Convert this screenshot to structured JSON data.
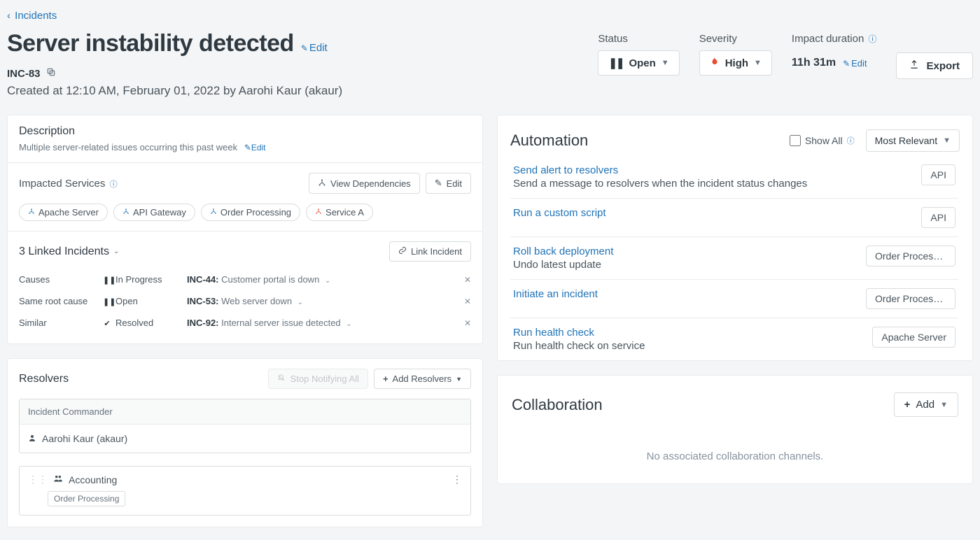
{
  "breadcrumb": {
    "label": "Incidents"
  },
  "title": "Server instability detected",
  "title_edit": "Edit",
  "incident_id": "INC-83",
  "created_line": "Created at 12:10 AM, February 01, 2022 by Aarohi Kaur (akaur)",
  "status": {
    "label": "Status",
    "value": "Open"
  },
  "severity": {
    "label": "Severity",
    "value": "High"
  },
  "impact": {
    "label": "Impact duration",
    "value": "11h 31m",
    "edit": "Edit"
  },
  "export_label": "Export",
  "description": {
    "heading": "Description",
    "text": "Multiple server-related issues occurring this past week",
    "edit": "Edit"
  },
  "impacted": {
    "heading": "Impacted Services",
    "view_deps": "View Dependencies",
    "edit": "Edit",
    "services": [
      {
        "name": "Apache Server",
        "alert": false
      },
      {
        "name": "API Gateway",
        "alert": false
      },
      {
        "name": "Order Processing",
        "alert": false
      },
      {
        "name": "Service A",
        "alert": true
      }
    ]
  },
  "linked": {
    "heading": "3 Linked Incidents",
    "link_btn": "Link Incident",
    "rows": [
      {
        "relation": "Causes",
        "status": "In Progress",
        "status_icon": "pause",
        "id": "INC-44",
        "title": "Customer portal is down"
      },
      {
        "relation": "Same root cause",
        "status": "Open",
        "status_icon": "pause",
        "id": "INC-53",
        "title": "Web server down"
      },
      {
        "relation": "Similar",
        "status": "Resolved",
        "status_icon": "check",
        "id": "INC-92",
        "title": "Internal server issue detected"
      }
    ]
  },
  "resolvers": {
    "heading": "Resolvers",
    "stop_notify": "Stop Notifying All",
    "add": "Add Resolvers",
    "commander_label": "Incident Commander",
    "commander_name": "Aarohi Kaur (akaur)",
    "group": {
      "name": "Accounting",
      "tag": "Order Processing"
    }
  },
  "automation": {
    "heading": "Automation",
    "show_all": "Show All",
    "sort": "Most Relevant",
    "items": [
      {
        "title": "Send alert to resolvers",
        "desc": "Send a message to resolvers when the incident status changes",
        "badge": "API"
      },
      {
        "title": "Run a custom script",
        "desc": "",
        "badge": "API"
      },
      {
        "title": "Roll back deployment",
        "desc": "Undo latest update",
        "badge": "Order Processing"
      },
      {
        "title": "Initiate an incident",
        "desc": "",
        "badge": "Order Processing"
      },
      {
        "title": "Run health check",
        "desc": "Run health check on service",
        "badge": "Apache Server"
      }
    ]
  },
  "collaboration": {
    "heading": "Collaboration",
    "add": "Add",
    "empty": "No associated collaboration channels."
  }
}
